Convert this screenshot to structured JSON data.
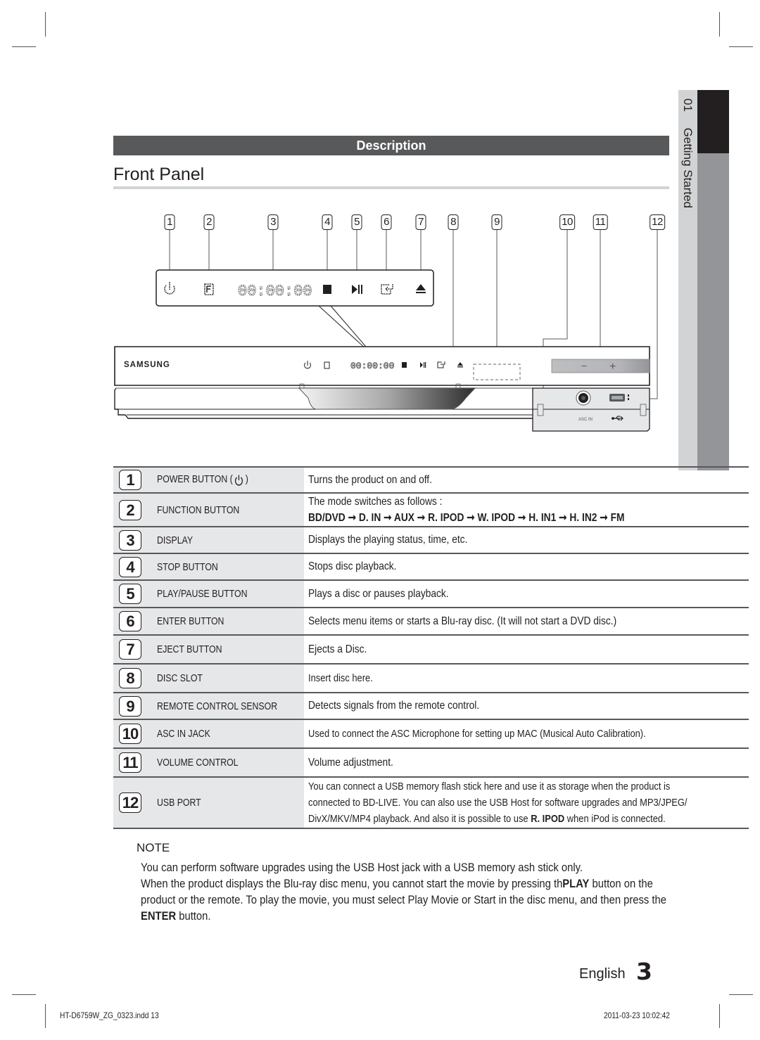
{
  "side_tab": {
    "chapter_number": "01",
    "chapter_title": "Getting Started"
  },
  "header": {
    "section": "Description",
    "title": "Front Panel"
  },
  "diagram": {
    "callouts": [
      "1",
      "2",
      "3",
      "4",
      "5",
      "6",
      "7",
      "8",
      "9",
      "10",
      "11",
      "12"
    ],
    "display_readout": "00:00:00",
    "brand": "SAMSUNG",
    "volume_minus": "−",
    "volume_plus": "+",
    "asc_in_label": "ASC IN",
    "usb_symbol": "⭠"
  },
  "table": {
    "rows": [
      {
        "num": "1",
        "label": "POWER BUTTON (",
        "label_suffix": ")",
        "desc": "Turns the product on and off."
      },
      {
        "num": "2",
        "label": "FUNCTION BUTTON",
        "desc": "The mode switches as follows :",
        "desc2": "BD/DVD ➞ D. IN ➞ AUX ➞ R. IPOD ➞ W. IPOD ➞ H. IN1 ➞ H. IN2 ➞ FM"
      },
      {
        "num": "3",
        "label": "DISPLAY",
        "desc": "Displays the playing status, time, etc."
      },
      {
        "num": "4",
        "label": "STOP BUTTON",
        "desc": "Stops disc playback."
      },
      {
        "num": "5",
        "label": "PLAY/PAUSE BUTTON",
        "desc": "Plays a disc or pauses playback."
      },
      {
        "num": "6",
        "label": "ENTER BUTTON",
        "desc": "Selects menu items or starts a Blu-ray disc. (It will not start a DVD disc.)"
      },
      {
        "num": "7",
        "label": "EJECT BUTTON",
        "desc": "Ejects a Disc."
      },
      {
        "num": "8",
        "label": "DISC SLOT",
        "desc": "Insert disc here."
      },
      {
        "num": "9",
        "label": "REMOTE CONTROL SENSOR",
        "desc": "Detects signals from the remote control."
      },
      {
        "num": "10",
        "label": "ASC IN JACK",
        "desc": "Used to connect the ASC Microphone for setting up MAC (Musical Auto Calibration)."
      },
      {
        "num": "11",
        "label": "VOLUME CONTROL",
        "desc": "Volume adjustment."
      },
      {
        "num": "12",
        "label": "USB PORT",
        "desc_lines": [
          "You can connect a USB memory flash stick here and use it as storage when the product is",
          "connected to BD-LIVE. You can also use the USB Host for software upgrades and MP3/JPEG/"
        ],
        "desc_last_pre": "DivX/MKV/MP4 playback. And also it is possible to use ",
        "desc_last_bold": "R. IPOD",
        "desc_last_post": " when iPod is connected."
      }
    ]
  },
  "note": {
    "title": "NOTE",
    "line1": "You can perform software upgrades using the USB Host jack with a USB memory  ash stick only.",
    "line2_pre": "When the product displays the Blu-ray disc menu, you cannot start the movie by pressing th",
    "line2_bold": "PLAY",
    "line2_post": " button on the",
    "line3": "product or the remote. To play the movie, you must select Play Movie or Start in the disc menu, and then press the",
    "line4_bold": "ENTER",
    "line4_post": " button."
  },
  "footer": {
    "language": "English",
    "page_number": "3",
    "file": "HT-D6759W_ZG_0323.indd   13",
    "date": "2011-03-23      10:02:42"
  }
}
